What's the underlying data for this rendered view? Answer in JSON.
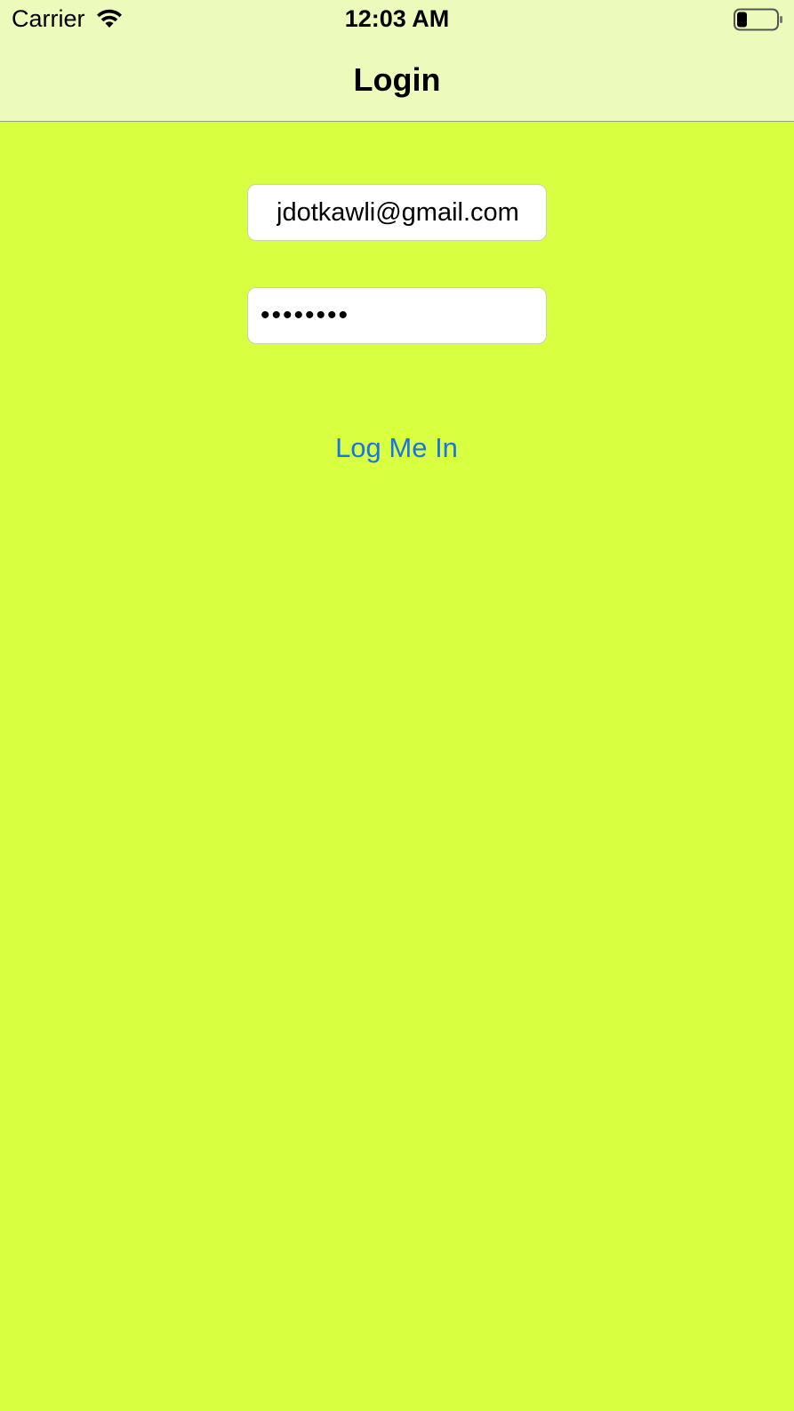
{
  "status_bar": {
    "carrier": "Carrier",
    "time": "12:03 AM",
    "wifi_icon": "wifi-icon",
    "battery_icon": "battery-low-icon"
  },
  "nav": {
    "title": "Login"
  },
  "form": {
    "email_value": "jdotkawli@gmail.com",
    "password_value": "........",
    "button_label": "Log Me In"
  },
  "colors": {
    "background": "#d8ff40",
    "nav_background": "#ecfabc",
    "button_text": "#1a73e8"
  }
}
